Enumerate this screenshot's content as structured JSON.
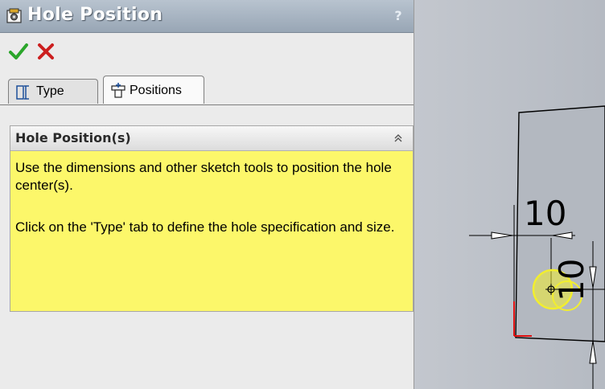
{
  "window": {
    "title": "Hole Position",
    "help_label": "?"
  },
  "tabs": [
    {
      "label": "Type"
    },
    {
      "label": "Positions"
    }
  ],
  "group": {
    "title": "Hole Position(s)",
    "messages": [
      "Use the dimensions and other sketch tools to position the hole center(s).",
      "Click on the 'Type' tab to define the hole specification and size."
    ]
  },
  "viewport": {
    "dimension_horizontal": "10",
    "dimension_vertical": "10"
  },
  "colors": {
    "titlebar": "#98a6b5",
    "message_background": "#fcf76a",
    "ok_green": "#2aa52a",
    "cancel_red": "#cc1f1f",
    "hole_yellow": "#f2ee2e"
  }
}
